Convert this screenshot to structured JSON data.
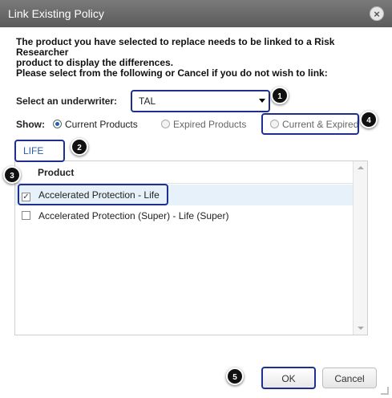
{
  "dialog": {
    "title": "Link Existing Policy",
    "close_glyph": "×",
    "intro_lines": [
      "The product you have selected to replace needs to be linked to a Risk Researcher",
      "product to display the differences.",
      "Please select from the following or Cancel if you do not wish to link:"
    ]
  },
  "underwriter": {
    "label": "Select an underwriter:",
    "value": "TAL"
  },
  "show": {
    "label": "Show:",
    "options": [
      {
        "label": "Current Products",
        "checked": true
      },
      {
        "label": "Expired Products",
        "checked": false
      },
      {
        "label": "Current & Expired",
        "checked": false
      }
    ]
  },
  "tabs": [
    {
      "label": "LIFE"
    }
  ],
  "product_table": {
    "header": "Product",
    "rows": [
      {
        "label": "Accelerated Protection - Life",
        "checked": true,
        "check_glyph": "✓"
      },
      {
        "label": "Accelerated Protection (Super) - Life (Super)",
        "checked": false,
        "check_glyph": ""
      }
    ]
  },
  "buttons": {
    "ok": "OK",
    "cancel": "Cancel"
  },
  "callouts": [
    "1",
    "2",
    "3",
    "4",
    "5"
  ],
  "colors": {
    "highlight_border": "#1f2f8f",
    "selected_row": "#e6f1f9",
    "titlebar": "#6a6a6a",
    "accent": "#2a5db0"
  },
  "icons": [
    "close-icon",
    "dropdown-arrow-icon",
    "scroll-up-icon",
    "scroll-down-icon",
    "resize-grip-icon"
  ]
}
